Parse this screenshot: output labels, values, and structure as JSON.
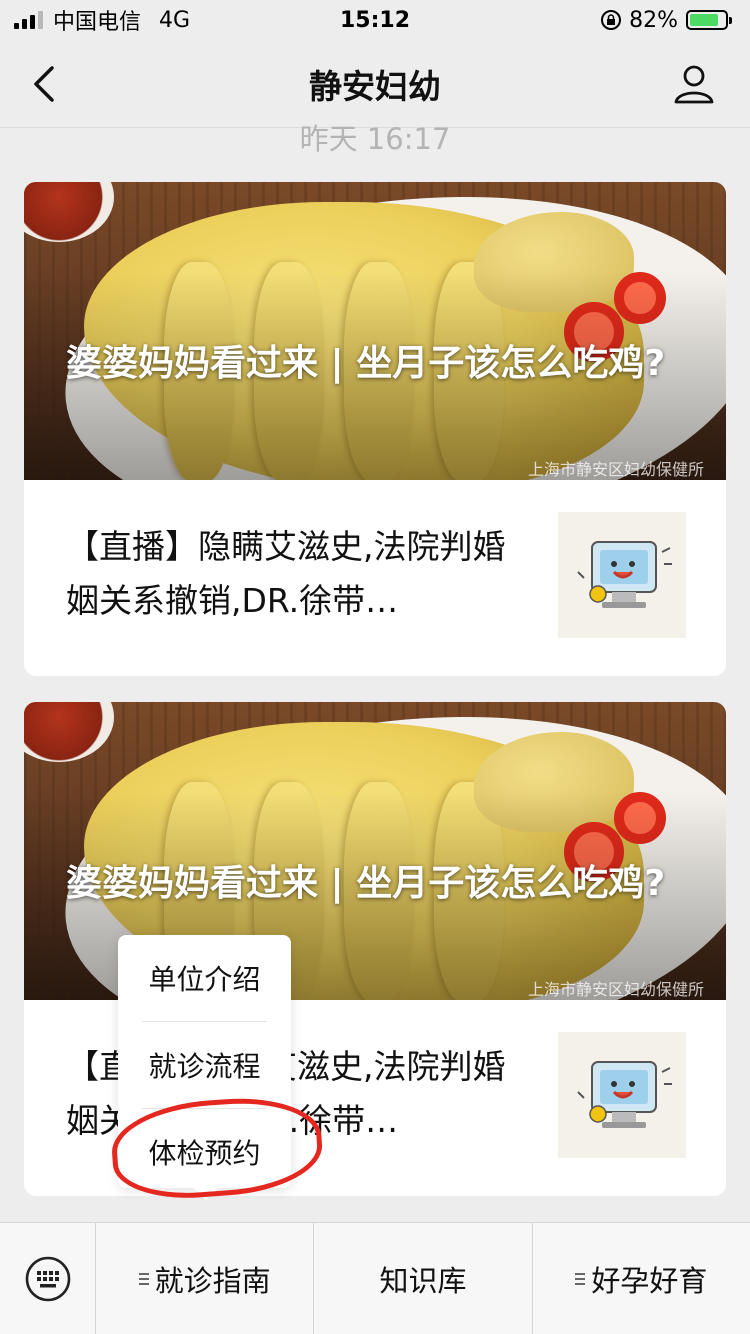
{
  "status_bar": {
    "carrier": "中国电信",
    "network": "4G",
    "time": "15:12",
    "battery": "82%",
    "battery_level": 0.82
  },
  "nav": {
    "title": "静安妇幼",
    "back_icon": "chevron-left-icon",
    "profile_icon": "user-icon"
  },
  "feed": {
    "timestamp": "昨天 16:17",
    "articles": [
      {
        "hero_title": "婆婆妈妈看过来 | 坐月子该怎么吃鸡?",
        "watermark": "上海市静安区妇幼保健所",
        "sub_title": "【直播】隐瞒艾滋史,法院判婚姻关系撤销,DR.徐带…"
      },
      {
        "hero_title": "婆婆妈妈看过来 | 坐月子该怎么吃鸡?",
        "watermark": "上海市静安区妇幼保健所",
        "sub_title": "【直播】隐瞒艾滋史,法院判婚姻关系撤销,DR.徐带…"
      }
    ]
  },
  "popup": {
    "items": [
      "单位介绍",
      "就诊流程",
      "体检预约"
    ],
    "highlighted": "体检预约",
    "highlight_color": "#e5281f"
  },
  "bottom_menu": {
    "keyboard_icon": "keyboard-icon",
    "items": [
      "就诊指南",
      "知识库",
      "好孕好育"
    ]
  }
}
